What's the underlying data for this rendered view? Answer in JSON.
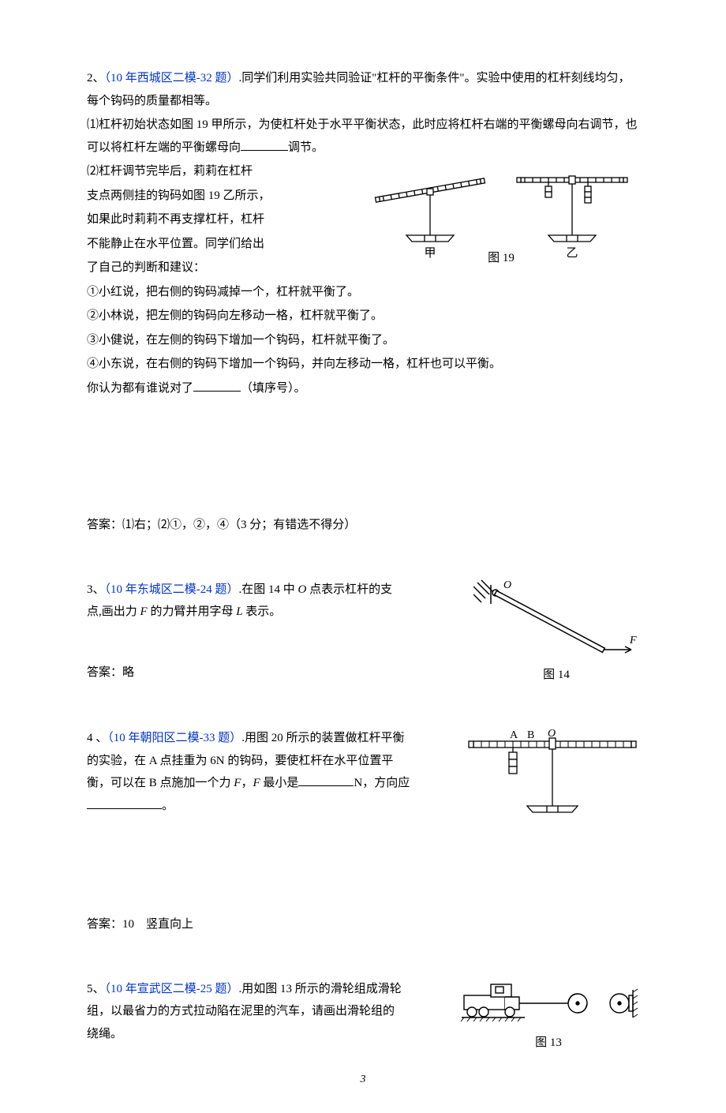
{
  "q2": {
    "num": "2、",
    "source": "（10 年西城区二模-32 题）",
    "lead": ".同学们利用实验共同验证\"杠杆的平衡条件\"。实验中使用的杠杆刻线均匀，每个钩码的质量都相等。",
    "p1a": "⑴杠杆初始状态如图 19 甲所示，为使杠杆处于水平平衡状态，此时应将杠杆右端的平衡螺母向右调节，也可以将杠杆左端的平衡螺母向",
    "p1b": "调节。",
    "p2": "⑵杠杆调节完毕后，莉莉在杠杆",
    "p3": "支点两侧挂的钩码如图 19 乙所示，",
    "p4": "如果此时莉莉不再支撑杠杆，杠杆",
    "p5": "不能静止在水平位置。同学们给出",
    "p6": "了自己的判断和建议：",
    "s1": "①小红说，把右侧的钩码减掉一个，杠杆就平衡了。",
    "s2": "②小林说，把左侧的钩码向左移动一格，杠杆就平衡了。",
    "s3": "③小健说，在左侧的钩码下增加一个钩码，杠杆就平衡了。",
    "s4": "④小东说，在右侧的钩码下增加一个钩码，并向左移动一格，杠杆也可以平衡。",
    "qa": "你认为都有谁说对了",
    "qb": "（填序号）。",
    "fig_a": "甲",
    "fig_b": "乙",
    "fig_label": "图 19",
    "answer": "答案：⑴右；⑵①，②，④（3 分；有错选不得分）"
  },
  "q3": {
    "num": "3、",
    "source": "（10 年东城区二模-24 题）",
    "t1": ".在图 14 中 ",
    "tO": "O",
    "t2": " 点表示杠杆的支点,画出力 ",
    "tF": "F",
    "t3": " 的力臂并用字母 ",
    "tL": "L",
    "t4": " 表示。",
    "labelO": "O",
    "labelF": "F",
    "fig_label": "图 14",
    "answer": "答案：略"
  },
  "q4": {
    "num": "4 、",
    "source": "（10 年朝阳区二模-33 题）",
    "t1": ".用图 20 所示的装置做杠杆平衡的实验，在 A 点挂重为 6N 的钩码，要使杠杆在水平位置平衡，可以在 B 点施加一个力 ",
    "tF": "F",
    "t2": "，",
    "tF2": "F",
    "t3": " 最小是",
    "t4": "N，方向应",
    "t5": "。",
    "labelA": "A",
    "labelB": "B",
    "labelO": "O",
    "answer": "答案：10    竖直向上"
  },
  "q5": {
    "num": "5、",
    "source": "（10 年宣武区二模-25 题）",
    "text": ".用如图 13 所示的滑轮组成滑轮组，以最省力的方式拉动陷在泥里的汽车，请画出滑轮组的绕绳。",
    "fig_label": "图 13"
  },
  "page_num": "3"
}
